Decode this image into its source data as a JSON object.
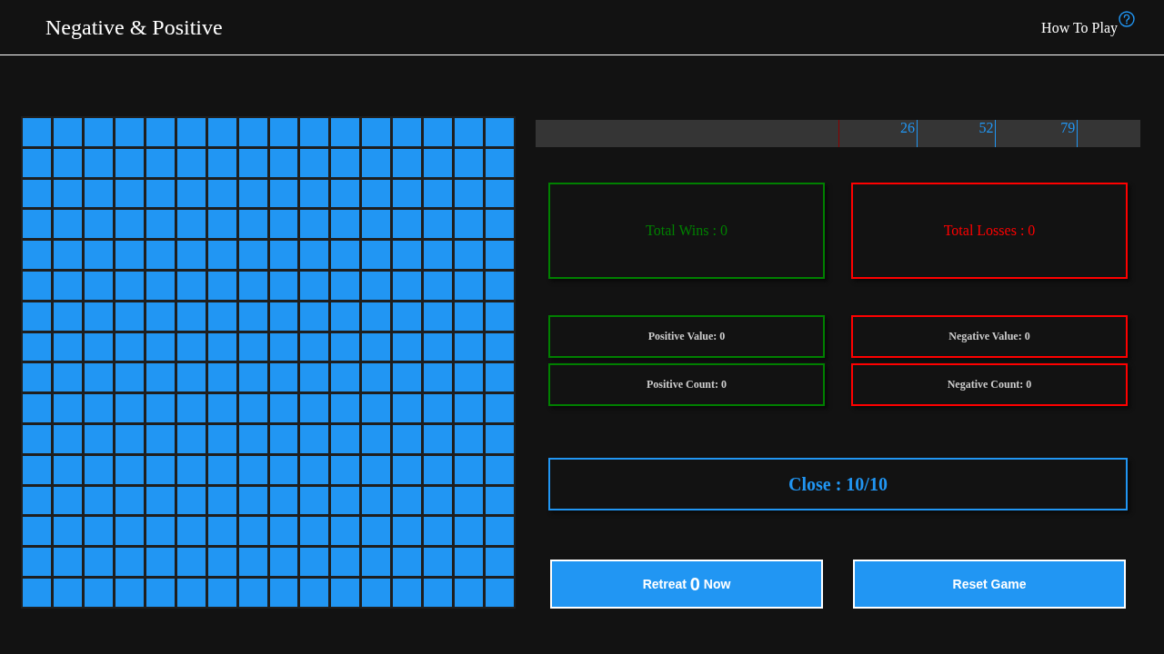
{
  "header": {
    "title": "Negative & Positive",
    "help_link": "How To Play"
  },
  "board": {
    "rows": [
      {
        "tiles": [
          {
            "revealed": false
          },
          {
            "revealed": false
          },
          {
            "revealed": false
          },
          {
            "revealed": false
          },
          {
            "revealed": false
          },
          {
            "revealed": false
          },
          {
            "revealed": false
          },
          {
            "revealed": false
          },
          {
            "revealed": false
          },
          {
            "revealed": false
          },
          {
            "revealed": false
          },
          {
            "revealed": false
          },
          {
            "revealed": false
          },
          {
            "revealed": false
          },
          {
            "revealed": false
          },
          {
            "revealed": false
          }
        ]
      },
      {
        "tiles": [
          {
            "revealed": false
          },
          {
            "revealed": false
          },
          {
            "revealed": false
          },
          {
            "revealed": false
          },
          {
            "revealed": false
          },
          {
            "revealed": false
          },
          {
            "revealed": false
          },
          {
            "revealed": false
          },
          {
            "revealed": false
          },
          {
            "revealed": false
          },
          {
            "revealed": false
          },
          {
            "revealed": false
          },
          {
            "revealed": false
          },
          {
            "revealed": false
          },
          {
            "revealed": false
          },
          {
            "revealed": false
          }
        ]
      },
      {
        "tiles": [
          {
            "revealed": false
          },
          {
            "revealed": false
          },
          {
            "revealed": false
          },
          {
            "revealed": false
          },
          {
            "revealed": false
          },
          {
            "revealed": false
          },
          {
            "revealed": false
          },
          {
            "revealed": false
          },
          {
            "revealed": false
          },
          {
            "revealed": false
          },
          {
            "revealed": false
          },
          {
            "revealed": false
          },
          {
            "revealed": false
          },
          {
            "revealed": false
          },
          {
            "revealed": false
          },
          {
            "revealed": false
          }
        ]
      },
      {
        "tiles": [
          {
            "revealed": false
          },
          {
            "revealed": false
          },
          {
            "revealed": false
          },
          {
            "revealed": false
          },
          {
            "revealed": false
          },
          {
            "revealed": false
          },
          {
            "revealed": false
          },
          {
            "revealed": false
          },
          {
            "revealed": false
          },
          {
            "revealed": false
          },
          {
            "revealed": false
          },
          {
            "revealed": false
          },
          {
            "revealed": false
          },
          {
            "revealed": false
          },
          {
            "revealed": false
          },
          {
            "revealed": false
          }
        ]
      },
      {
        "tiles": [
          {
            "revealed": false
          },
          {
            "revealed": false
          },
          {
            "revealed": false
          },
          {
            "revealed": false
          },
          {
            "revealed": false
          },
          {
            "revealed": false
          },
          {
            "revealed": false
          },
          {
            "revealed": false
          },
          {
            "revealed": false
          },
          {
            "revealed": false
          },
          {
            "revealed": false
          },
          {
            "revealed": false
          },
          {
            "revealed": false
          },
          {
            "revealed": false
          },
          {
            "revealed": false
          },
          {
            "revealed": false
          }
        ]
      },
      {
        "tiles": [
          {
            "revealed": false
          },
          {
            "revealed": false
          },
          {
            "revealed": false
          },
          {
            "revealed": false
          },
          {
            "revealed": false
          },
          {
            "revealed": false
          },
          {
            "revealed": false
          },
          {
            "revealed": false
          },
          {
            "revealed": false
          },
          {
            "revealed": false
          },
          {
            "revealed": false
          },
          {
            "revealed": false
          },
          {
            "revealed": false
          },
          {
            "revealed": false
          },
          {
            "revealed": false
          },
          {
            "revealed": false
          }
        ]
      },
      {
        "tiles": [
          {
            "revealed": false
          },
          {
            "revealed": false
          },
          {
            "revealed": false
          },
          {
            "revealed": false
          },
          {
            "revealed": false
          },
          {
            "revealed": false
          },
          {
            "revealed": false
          },
          {
            "revealed": false
          },
          {
            "revealed": false
          },
          {
            "revealed": false
          },
          {
            "revealed": false
          },
          {
            "revealed": false
          },
          {
            "revealed": false
          },
          {
            "revealed": false
          },
          {
            "revealed": false
          },
          {
            "revealed": false
          }
        ]
      },
      {
        "tiles": [
          {
            "revealed": false
          },
          {
            "revealed": false
          },
          {
            "revealed": false
          },
          {
            "revealed": false
          },
          {
            "revealed": false
          },
          {
            "revealed": false
          },
          {
            "revealed": false
          },
          {
            "revealed": false
          },
          {
            "revealed": false
          },
          {
            "revealed": false
          },
          {
            "revealed": false
          },
          {
            "revealed": false
          },
          {
            "revealed": false
          },
          {
            "revealed": false
          },
          {
            "revealed": false
          },
          {
            "revealed": false
          }
        ]
      },
      {
        "tiles": [
          {
            "revealed": false
          },
          {
            "revealed": false
          },
          {
            "revealed": false
          },
          {
            "revealed": false
          },
          {
            "revealed": false
          },
          {
            "revealed": false
          },
          {
            "revealed": false
          },
          {
            "revealed": false
          },
          {
            "revealed": false
          },
          {
            "revealed": false
          },
          {
            "revealed": false
          },
          {
            "revealed": false
          },
          {
            "revealed": false
          },
          {
            "revealed": false
          },
          {
            "revealed": false
          },
          {
            "revealed": false
          }
        ]
      },
      {
        "tiles": [
          {
            "revealed": false
          },
          {
            "revealed": false
          },
          {
            "revealed": false
          },
          {
            "revealed": false
          },
          {
            "revealed": false
          },
          {
            "revealed": false
          },
          {
            "revealed": false
          },
          {
            "revealed": false
          },
          {
            "revealed": false
          },
          {
            "revealed": false
          },
          {
            "revealed": false
          },
          {
            "revealed": false
          },
          {
            "revealed": false
          },
          {
            "revealed": false
          },
          {
            "revealed": false
          },
          {
            "revealed": false
          }
        ]
      },
      {
        "tiles": [
          {
            "revealed": false
          },
          {
            "revealed": false
          },
          {
            "revealed": false
          },
          {
            "revealed": false
          },
          {
            "revealed": false
          },
          {
            "revealed": false
          },
          {
            "revealed": false
          },
          {
            "revealed": false
          },
          {
            "revealed": false
          },
          {
            "revealed": false
          },
          {
            "revealed": false
          },
          {
            "revealed": false
          },
          {
            "revealed": false
          },
          {
            "revealed": false
          },
          {
            "revealed": false
          },
          {
            "revealed": false
          }
        ]
      },
      {
        "tiles": [
          {
            "revealed": false
          },
          {
            "revealed": false
          },
          {
            "revealed": false
          },
          {
            "revealed": false
          },
          {
            "revealed": false
          },
          {
            "revealed": false
          },
          {
            "revealed": false
          },
          {
            "revealed": false
          },
          {
            "revealed": false
          },
          {
            "revealed": false
          },
          {
            "revealed": false
          },
          {
            "revealed": false
          },
          {
            "revealed": false
          },
          {
            "revealed": false
          },
          {
            "revealed": false
          },
          {
            "revealed": false
          }
        ]
      },
      {
        "tiles": [
          {
            "revealed": false
          },
          {
            "revealed": false
          },
          {
            "revealed": false
          },
          {
            "revealed": false
          },
          {
            "revealed": false
          },
          {
            "revealed": false
          },
          {
            "revealed": false
          },
          {
            "revealed": false
          },
          {
            "revealed": false
          },
          {
            "revealed": false
          },
          {
            "revealed": false
          },
          {
            "revealed": false
          },
          {
            "revealed": false
          },
          {
            "revealed": false
          },
          {
            "revealed": false
          },
          {
            "revealed": false
          }
        ]
      },
      {
        "tiles": [
          {
            "revealed": false
          },
          {
            "revealed": false
          },
          {
            "revealed": false
          },
          {
            "revealed": false
          },
          {
            "revealed": false
          },
          {
            "revealed": false
          },
          {
            "revealed": false
          },
          {
            "revealed": false
          },
          {
            "revealed": false
          },
          {
            "revealed": false
          },
          {
            "revealed": false
          },
          {
            "revealed": false
          },
          {
            "revealed": false
          },
          {
            "revealed": false
          },
          {
            "revealed": false
          },
          {
            "revealed": false
          }
        ]
      },
      {
        "tiles": [
          {
            "revealed": false
          },
          {
            "revealed": false
          },
          {
            "revealed": false
          },
          {
            "revealed": false
          },
          {
            "revealed": false
          },
          {
            "revealed": false
          },
          {
            "revealed": false
          },
          {
            "revealed": false
          },
          {
            "revealed": false
          },
          {
            "revealed": false
          },
          {
            "revealed": false
          },
          {
            "revealed": false
          },
          {
            "revealed": false
          },
          {
            "revealed": false
          },
          {
            "revealed": false
          },
          {
            "revealed": false
          }
        ]
      },
      {
        "tiles": [
          {
            "revealed": false
          },
          {
            "revealed": false
          },
          {
            "revealed": false
          },
          {
            "revealed": false
          },
          {
            "revealed": false
          },
          {
            "revealed": false
          },
          {
            "revealed": false
          },
          {
            "revealed": false
          },
          {
            "revealed": false
          },
          {
            "revealed": false
          },
          {
            "revealed": false
          },
          {
            "revealed": false
          },
          {
            "revealed": false
          },
          {
            "revealed": false
          },
          {
            "revealed": false
          },
          {
            "revealed": false
          }
        ]
      }
    ]
  },
  "scale": {
    "markers": [
      {
        "label": "26",
        "level": 0.63
      },
      {
        "label": "52",
        "level": 0.76
      },
      {
        "label": "79",
        "level": 0.895
      }
    ],
    "current": {
      "level": 0.5
    }
  },
  "totals": [
    {
      "label": "Total Wins : 0",
      "color": "#008000"
    },
    {
      "label": "Total Losses : 0",
      "color": "#ff0000"
    }
  ],
  "counters": [
    {
      "label": "Positive Value: 0",
      "color": "#008000"
    },
    {
      "label": "Negative Value: 0",
      "color": "#ff0000"
    },
    {
      "label": "Positive Count: 0",
      "color": "#008000"
    },
    {
      "label": "Negative Count: 0",
      "color": "#ff0000"
    }
  ],
  "close_status": "Close : 10/10",
  "buttons": [
    {
      "kind": "retreat",
      "label_before": "Retreat",
      "count": "0",
      "label_after": "Now"
    },
    {
      "kind": "reset",
      "label": "Reset Game"
    }
  ]
}
